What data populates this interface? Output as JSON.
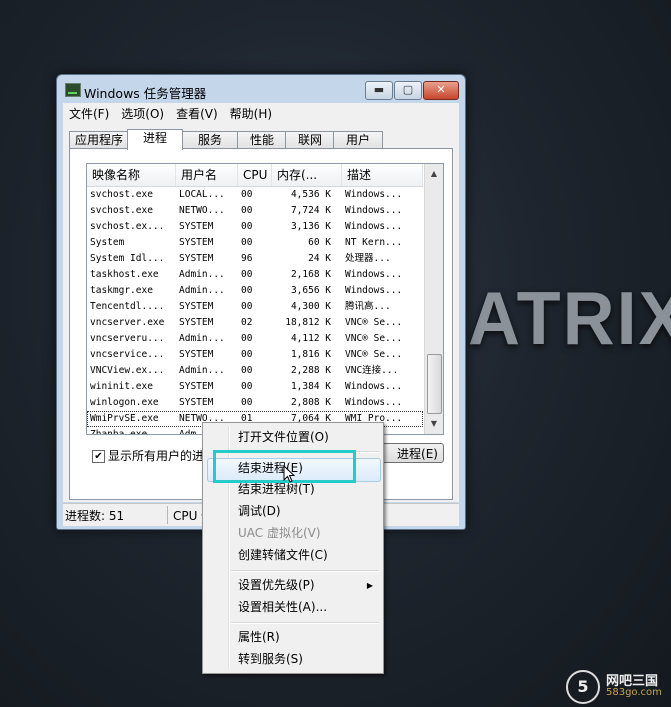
{
  "background": {
    "brand_text": "ATRIX"
  },
  "watermark": {
    "logo_char": "5",
    "name": "网吧三国",
    "url": "583go.com"
  },
  "window": {
    "title": "Windows 任务管理器",
    "controls": {
      "minimize": "▬",
      "maximize": "▢",
      "close": "✕"
    },
    "menu": [
      "文件(F)",
      "选项(O)",
      "查看(V)",
      "帮助(H)"
    ],
    "tabs": [
      "应用程序",
      "进程",
      "服务",
      "性能",
      "联网",
      "用户"
    ],
    "active_tab": "进程",
    "columns": [
      "映像名称",
      "用户名",
      "CPU",
      "内存(...",
      "描述"
    ],
    "rows": [
      [
        "svchost.exe",
        "LOCAL...",
        "00",
        "4,536 K",
        "Windows..."
      ],
      [
        "svchost.exe",
        "NETWO...",
        "00",
        "7,724 K",
        "Windows..."
      ],
      [
        "svchost.ex...",
        "SYSTEM",
        "00",
        "3,136 K",
        "Windows..."
      ],
      [
        "System",
        "SYSTEM",
        "00",
        "60 K",
        "NT Kern..."
      ],
      [
        "System Idl...",
        "SYSTEM",
        "96",
        "24 K",
        "处理器..."
      ],
      [
        "taskhost.exe",
        "Admin...",
        "00",
        "2,168 K",
        "Windows..."
      ],
      [
        "taskmgr.exe",
        "Admin...",
        "00",
        "3,656 K",
        "Windows..."
      ],
      [
        "Tencentdl....",
        "SYSTEM",
        "00",
        "4,300 K",
        "腾讯高..."
      ],
      [
        "vncserver.exe",
        "SYSTEM",
        "02",
        "18,812 K",
        "VNC® Se..."
      ],
      [
        "vncserveru...",
        "Admin...",
        "00",
        "4,112 K",
        "VNC® Se..."
      ],
      [
        "vncservice...",
        "SYSTEM",
        "00",
        "1,816 K",
        "VNC® Se..."
      ],
      [
        "VNCView.ex...",
        "Admin...",
        "00",
        "2,288 K",
        "VNC连接..."
      ],
      [
        "wininit.exe",
        "SYSTEM",
        "00",
        "1,384 K",
        "Windows..."
      ],
      [
        "winlogon.exe",
        "SYSTEM",
        "00",
        "2,808 K",
        "Windows..."
      ],
      [
        "WmiPrvSE.exe",
        "NETWO...",
        "01",
        "7,064 K",
        "WMI Pro..."
      ],
      [
        "Zhanba.exe...",
        "Adm",
        "",
        "",
        "..."
      ]
    ],
    "selected_row": 14,
    "show_all_users_label": "显示所有用户的进程",
    "show_all_users_checked": "✔",
    "end_process_button": "进程(E)",
    "status": {
      "processes": "进程数: 51",
      "cpu": "CPU 使"
    }
  },
  "context_menu": {
    "items": [
      {
        "label": "打开文件位置(O)",
        "disabled": false
      },
      {
        "label": "结束进程(E)",
        "disabled": false,
        "hovered": true
      },
      {
        "label": "结束进程树(T)",
        "disabled": false
      },
      {
        "label": "调试(D)",
        "disabled": false
      },
      {
        "label": "UAC 虚拟化(V)",
        "disabled": true
      },
      {
        "label": "创建转储文件(C)",
        "disabled": false
      },
      {
        "label": "设置优先级(P)",
        "disabled": false,
        "submenu": true
      },
      {
        "label": "设置相关性(A)...",
        "disabled": false
      },
      {
        "label": "属性(R)",
        "disabled": false
      },
      {
        "label": "转到服务(S)",
        "disabled": false
      }
    ],
    "highlight_color": "#24cbc9"
  }
}
